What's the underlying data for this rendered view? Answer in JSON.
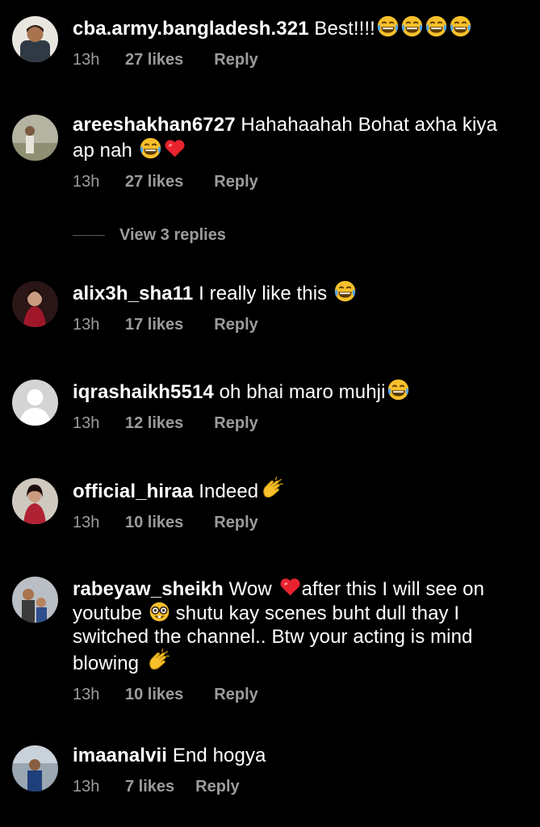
{
  "comments": [
    {
      "username": "cba.army.bangladesh.321",
      "text": " Best!!!!",
      "emojis": [
        "laugh-tears-emoji",
        "laugh-tears-emoji",
        "laugh-tears-emoji",
        "laugh-tears-emoji"
      ],
      "time": "13h",
      "likes": "27 likes",
      "reply": "Reply",
      "avatar_color": "#5b5b5b"
    },
    {
      "username": "areeshakhan6727",
      "text": " Hahahaahah Bohat axha kiya ap nah ",
      "emojis": [
        "laugh-tears-emoji",
        "red-heart-emoji"
      ],
      "time": "13h",
      "likes": "27 likes",
      "reply": "Reply",
      "avatar_color": "#a7a38d"
    },
    {
      "username": "alix3h_sha11",
      "text": " I really like this ",
      "emojis": [
        "laugh-tears-emoji"
      ],
      "time": "13h",
      "likes": "17 likes",
      "reply": "Reply",
      "avatar_color": "#3a1a1a"
    },
    {
      "username": "iqrashaikh5514",
      "text": " oh bhai maro muhji",
      "emojis": [
        "laugh-tears-emoji"
      ],
      "time": "13h",
      "likes": "12 likes",
      "reply": "Reply",
      "avatar_color": "#cfcfcf"
    },
    {
      "username": "official_hiraa",
      "text": " Indeed",
      "emojis": [
        "clapping-hands-emoji"
      ],
      "time": "13h",
      "likes": "10 likes",
      "reply": "Reply",
      "avatar_color": "#c9c4bb"
    },
    {
      "username": "rabeyaw_sheikh",
      "text": " Wow ",
      "text2": "after this I will see on youtube ",
      "text3": " shutu kay scenes buht dull thay I switched the channel.. Btw your acting is mind blowing ",
      "emojis": [
        "red-heart-emoji",
        "nerd-face-emoji",
        "clapping-hands-emoji"
      ],
      "time": "13h",
      "likes": "10 likes",
      "reply": "Reply",
      "avatar_color": "#a9b0b5"
    },
    {
      "username": "imaanalvii",
      "text": " End hogya",
      "emojis": [],
      "time": "13h",
      "likes": "7 likes",
      "reply": "Reply",
      "avatar_color": "#9aa6b2"
    }
  ],
  "view_replies": "View 3 replies",
  "colors": {
    "background": "#000000",
    "primary_text": "#ffffff",
    "secondary_text": "#9c9c9c",
    "heart": "#e8232f",
    "emoji_yellow": "#f7c02b"
  }
}
